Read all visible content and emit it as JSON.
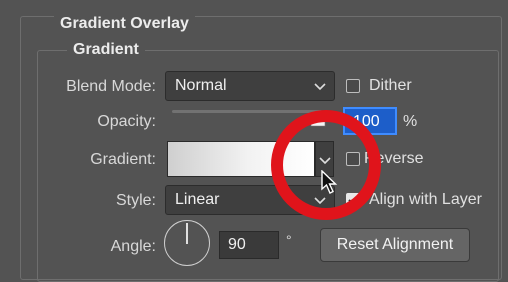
{
  "section": {
    "title": "Gradient Overlay",
    "subtitle": "Gradient"
  },
  "blend_mode": {
    "label": "Blend Mode:",
    "value": "Normal"
  },
  "dither": {
    "label": "Dither",
    "checked": false
  },
  "opacity": {
    "label": "Opacity:",
    "value_text": "100",
    "value": 100,
    "unit": "%"
  },
  "gradient": {
    "label": "Gradient:",
    "colors": [
      "#cfcfcf",
      "#ffffff"
    ],
    "reverse_label": "Reverse",
    "reverse_checked": false
  },
  "style": {
    "label": "Style:",
    "value": "Linear"
  },
  "align_with_layer": {
    "label": "Align with Layer",
    "checked": true
  },
  "angle": {
    "label": "Angle:",
    "value": "90",
    "unit": "°"
  },
  "reset_button": {
    "label": "Reset Alignment"
  },
  "colors": {
    "highlight_ring": "#e0141b",
    "field_focus": "#1d5ec9"
  },
  "icons": [
    "chevron-down-icon",
    "slider-thumb-icon",
    "mouse-pointer-icon",
    "angle-dial-icon",
    "checkmark-icon"
  ]
}
